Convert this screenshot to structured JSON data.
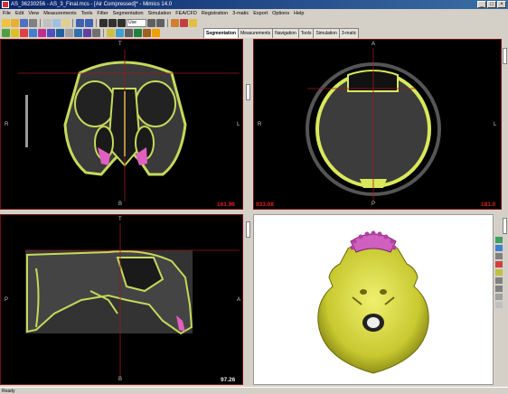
{
  "window": {
    "title": "AS_36230256 - AS_3_Final.mcs - [Air Compressed]* - Mimics 14.0"
  },
  "menu": [
    "File",
    "Edit",
    "View",
    "Measurements",
    "Tools",
    "Filter",
    "Segmentation",
    "Simulation",
    "FEA/CFD",
    "Registration",
    "3-matic",
    "Export",
    "Options",
    "Help"
  ],
  "toolbar": {
    "zoom_value": "Use"
  },
  "tabs": [
    "Segmentation",
    "Measurements",
    "Navigation",
    "Tools",
    "Simulation",
    "3-matic"
  ],
  "active_tab": "Segmentation",
  "viewports": {
    "coronal": {
      "top": "T",
      "bottom": "B",
      "left": "R",
      "right": "L",
      "value": "161.96"
    },
    "axial": {
      "top": "A",
      "bottom": "P",
      "left": "R",
      "right": "L",
      "value_left": "933.08",
      "value_right": "181.0"
    },
    "sagittal": {
      "top": "T",
      "bottom": "B",
      "left": "P",
      "right": "A",
      "value": "97.26"
    }
  },
  "colors": {
    "bone": "#d9e85a",
    "teeth": "#e060c0",
    "crosshair": "#9b1a1a",
    "border": "#7a1010"
  },
  "status": {
    "text": "Ready"
  }
}
